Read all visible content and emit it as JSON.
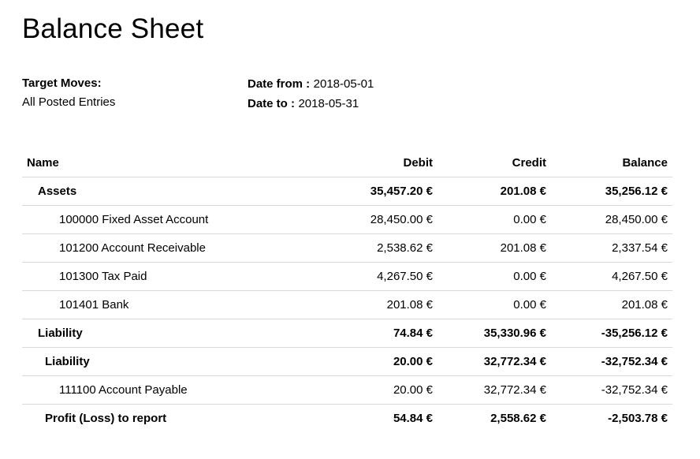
{
  "title": "Balance Sheet",
  "target_moves": {
    "label": "Target Moves:",
    "value": "All Posted Entries"
  },
  "date_from": {
    "label": "Date from :",
    "value": "2018-05-01"
  },
  "date_to": {
    "label": "Date to :",
    "value": "2018-05-31"
  },
  "table": {
    "headers": {
      "name": "Name",
      "debit": "Debit",
      "credit": "Credit",
      "balance": "Balance"
    },
    "rows": [
      {
        "name": "Assets",
        "debit": "35,457.20 €",
        "credit": "201.08 €",
        "balance": "35,256.12 €"
      },
      {
        "name": "100000 Fixed Asset Account",
        "debit": "28,450.00 €",
        "credit": "0.00 €",
        "balance": "28,450.00 €"
      },
      {
        "name": "101200 Account Receivable",
        "debit": "2,538.62 €",
        "credit": "201.08 €",
        "balance": "2,337.54 €"
      },
      {
        "name": "101300 Tax Paid",
        "debit": "4,267.50 €",
        "credit": "0.00 €",
        "balance": "4,267.50 €"
      },
      {
        "name": "101401 Bank",
        "debit": "201.08 €",
        "credit": "0.00 €",
        "balance": "201.08 €"
      },
      {
        "name": "Liability",
        "debit": "74.84 €",
        "credit": "35,330.96 €",
        "balance": "-35,256.12 €"
      },
      {
        "name": "Liability",
        "debit": "20.00 €",
        "credit": "32,772.34 €",
        "balance": "-32,752.34 €"
      },
      {
        "name": "111100 Account Payable",
        "debit": "20.00 €",
        "credit": "32,772.34 €",
        "balance": "-32,752.34 €"
      },
      {
        "name": "Profit (Loss) to report",
        "debit": "54.84 €",
        "credit": "2,558.62 €",
        "balance": "-2,503.78 €"
      }
    ]
  }
}
